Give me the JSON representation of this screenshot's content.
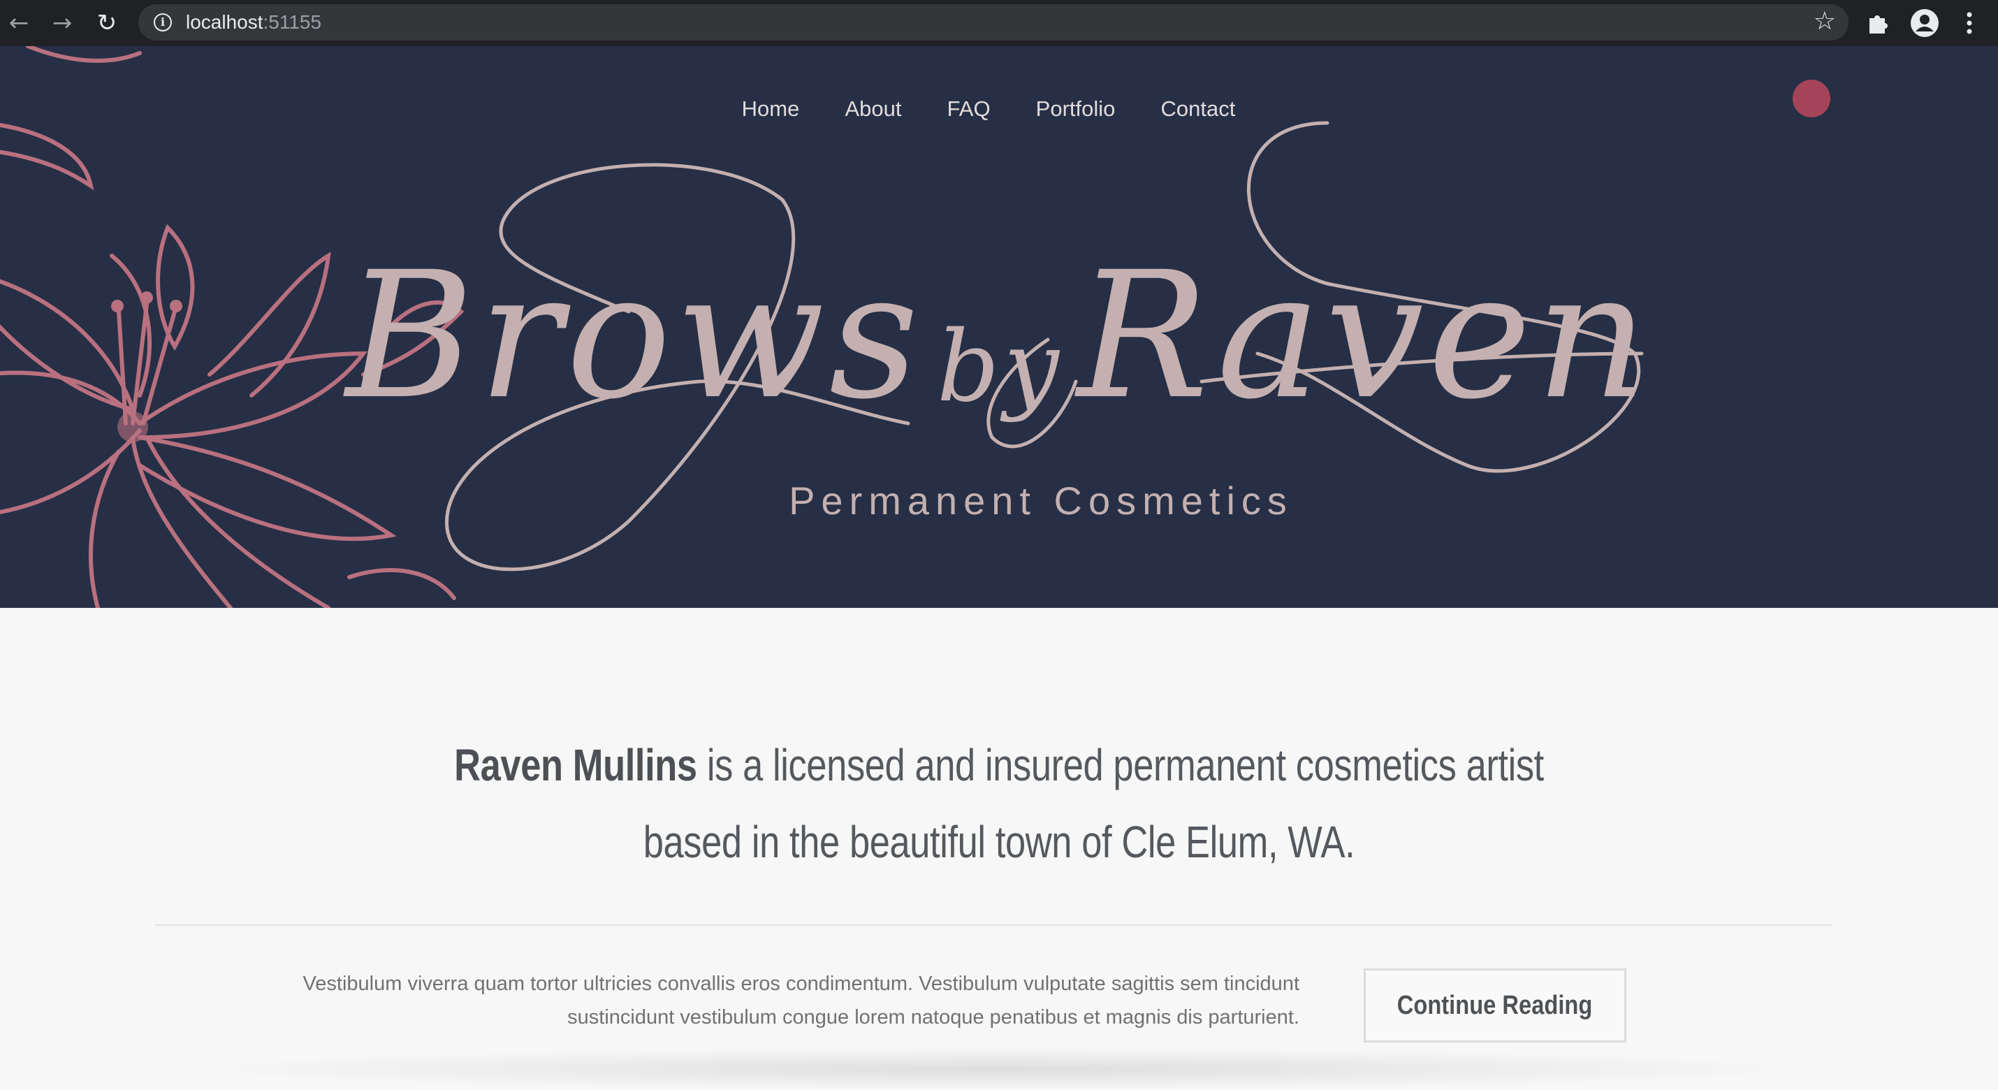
{
  "browser": {
    "url_host": "localhost",
    "url_port": ":51155",
    "icons": [
      "back-arrow-icon",
      "forward-arrow-icon",
      "reload-icon",
      "info-icon",
      "star-icon",
      "extensions-puzzle-icon",
      "profile-icon",
      "menu-kebab-icon"
    ]
  },
  "site": {
    "nav": [
      "Home",
      "About",
      "FAQ",
      "Portfolio",
      "Contact"
    ],
    "brand_main": "Brows",
    "brand_by": "by",
    "brand_name": "Raven",
    "tagline": "Permanent Cosmetics",
    "colors": {
      "hero_bg": "#262f45",
      "accent_pink": "#b4475a",
      "script": "#c4b0b0"
    }
  },
  "intro": {
    "name": "Raven Mullins",
    "line1_rest": " is a licensed and insured permanent cosmetics artist",
    "line2": "based in the beautiful town of Cle Elum, WA."
  },
  "excerpt": {
    "text": "Vestibulum viverra quam tortor ultricies convallis eros condimentum. Vestibulum vulputate sagittis sem tincidunt sustincidunt vestibulum congue lorem natoque penatibus et magnis dis parturient.",
    "button": "Continue Reading"
  }
}
